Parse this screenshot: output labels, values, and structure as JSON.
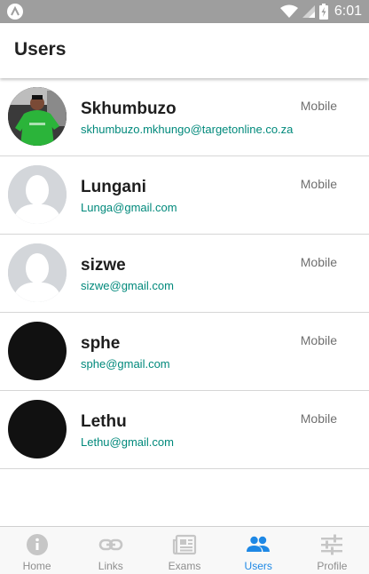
{
  "status_bar": {
    "time": "6:01"
  },
  "header": {
    "title": "Users"
  },
  "users": [
    {
      "name": "Skhumbuzo",
      "email": "skhumbuzo.mkhungo@targetonline.co.za",
      "device": "Mobile",
      "avatar": "photo"
    },
    {
      "name": "Lungani",
      "email": "Lunga@gmail.com",
      "device": "Mobile",
      "avatar": "placeholder"
    },
    {
      "name": "sizwe",
      "email": "sizwe@gmail.com",
      "device": "Mobile",
      "avatar": "placeholder"
    },
    {
      "name": "sphe",
      "email": "sphe@gmail.com",
      "device": "Mobile",
      "avatar": "black"
    },
    {
      "name": "Lethu",
      "email": "Lethu@gmail.com",
      "device": "Mobile",
      "avatar": "black"
    }
  ],
  "tabs": [
    {
      "label": "Home",
      "icon": "info-icon",
      "active": false
    },
    {
      "label": "Links",
      "icon": "link-icon",
      "active": false
    },
    {
      "label": "Exams",
      "icon": "newspaper-icon",
      "active": false
    },
    {
      "label": "Users",
      "icon": "people-icon",
      "active": true
    },
    {
      "label": "Profile",
      "icon": "sliders-icon",
      "active": false
    }
  ],
  "colors": {
    "accent": "#1e88e5",
    "email": "#00897b",
    "status_bar": "#9e9e9e"
  }
}
